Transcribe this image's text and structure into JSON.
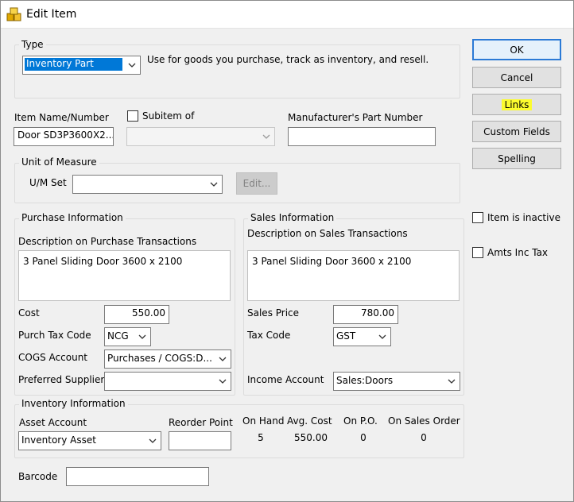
{
  "window": {
    "title": "Edit Item"
  },
  "type_section": {
    "title": "Type",
    "selected": "Inventory Part",
    "description": "Use for goods you purchase, track as inventory, and resell."
  },
  "buttons": {
    "ok": "OK",
    "cancel": "Cancel",
    "links": "Links",
    "custom_fields": "Custom Fields",
    "spelling": "Spelling",
    "um_edit": "Edit..."
  },
  "item": {
    "name_label": "Item Name/Number",
    "name_value": "Door SD3P3600X2...",
    "subitem_label": "Subitem of",
    "subitem_value": "",
    "mfr_label": "Manufacturer's Part Number",
    "mfr_value": ""
  },
  "unit_of_measure": {
    "title": "Unit of Measure",
    "um_set_label": "U/M Set",
    "um_set_value": ""
  },
  "checkboxes": {
    "inactive_label": "Item is inactive",
    "inactive_checked": false,
    "amts_inc_tax_label": "Amts Inc Tax",
    "amts_inc_tax_checked": false
  },
  "purchase": {
    "title": "Purchase Information",
    "desc_label": "Description on Purchase Transactions",
    "description": "3 Panel Sliding Door 3600 x 2100",
    "cost_label": "Cost",
    "cost": "550.00",
    "tax_code_label": "Purch Tax Code",
    "tax_code": "NCG",
    "cogs_label": "COGS Account",
    "cogs": "Purchases / COGS:D...",
    "supplier_label": "Preferred Supplier",
    "supplier": ""
  },
  "sales": {
    "title": "Sales Information",
    "desc_label": "Description on Sales Transactions",
    "description": "3 Panel Sliding Door 3600 x 2100",
    "price_label": "Sales Price",
    "price": "780.00",
    "tax_code_label": "Tax Code",
    "tax_code": "GST",
    "income_label": "Income Account",
    "income": "Sales:Doors"
  },
  "inventory": {
    "title": "Inventory Information",
    "asset_label": "Asset Account",
    "asset": "Inventory Asset",
    "reorder_label": "Reorder Point",
    "reorder_value": "",
    "on_hand_label": "On Hand",
    "on_hand": "5",
    "avg_cost_label": "Avg. Cost",
    "avg_cost": "550.00",
    "on_po_label": "On P.O.",
    "on_po": "0",
    "on_sales_order_label": "On Sales Order",
    "on_sales_order": "0"
  },
  "barcode": {
    "label": "Barcode",
    "value": ""
  },
  "colors": {
    "selection": "#0078d7",
    "highlight": "#fcfc2e",
    "default_button_border": "#2b7ad6"
  },
  "icons": [
    "app-icon",
    "chevron-down-icon"
  ]
}
